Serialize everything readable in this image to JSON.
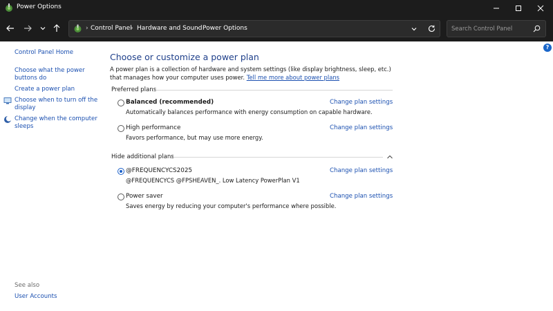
{
  "window": {
    "title": "Power Options"
  },
  "address": {
    "crumbs": [
      "Control Panel",
      "Hardware and Sound",
      "Power Options"
    ]
  },
  "search": {
    "placeholder": "Search Control Panel"
  },
  "sidebar": {
    "home": "Control Panel Home",
    "items": [
      {
        "label_lines": [
          "Choose what the power",
          "buttons do"
        ]
      },
      {
        "label_lines": [
          "Create a power plan"
        ]
      },
      {
        "label_lines": [
          "Choose when to turn off the",
          "display"
        ],
        "icon": "display-icon"
      },
      {
        "label_lines": [
          "Change when the computer",
          "sleeps"
        ],
        "icon": "moon-icon"
      }
    ],
    "see_also": "See also",
    "user_accounts": "User Accounts"
  },
  "main": {
    "title": "Choose or customize a power plan",
    "intro_text": "A power plan is a collection of hardware and system settings (like display brightness, sleep, etc.) that manages how your computer uses power.",
    "intro_link": "Tell me more about power plans",
    "preferred_label": "Preferred plans",
    "additional_label": "Hide additional plans",
    "change_link": "Change plan settings",
    "preferred_plans": [
      {
        "name": "Balanced (recommended)",
        "desc": "Automatically balances performance with energy consumption on capable hardware.",
        "selected": false
      },
      {
        "name": "High performance",
        "desc": "Favors performance, but may use more energy.",
        "selected": false
      }
    ],
    "additional_plans": [
      {
        "name": "@FREQUENCYCS2025",
        "desc": "@FREQUENCYCS @FPSHEAVEN_. Low Latency PowerPlan V1",
        "selected": true
      },
      {
        "name": "Power saver",
        "desc": "Saves energy by reducing your computer's performance where possible.",
        "selected": false
      }
    ]
  },
  "colors": {
    "titlebar": "#1c1c1c",
    "link": "#1a4fb0",
    "heading": "#1e3f8a",
    "accent": "#1a5fc8"
  }
}
